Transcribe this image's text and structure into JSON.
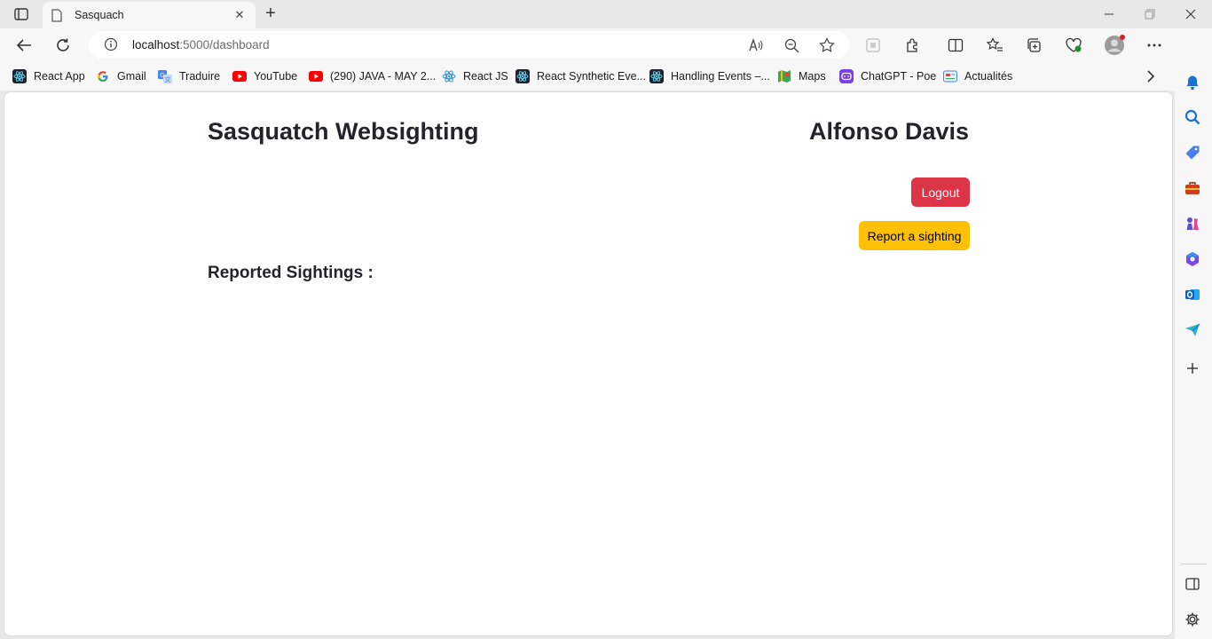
{
  "browser": {
    "tab": {
      "title": "Sasquach",
      "close_symbol": "✕"
    },
    "new_tab_symbol": "+",
    "address": {
      "host": "localhost",
      "path": ":5000/dashboard"
    },
    "window_controls": [
      "minimize-icon",
      "restore-icon",
      "close-icon"
    ],
    "bookmarks": [
      {
        "label": "React App",
        "icon": "react-icon"
      },
      {
        "label": "Gmail",
        "icon": "google-icon"
      },
      {
        "label": "Traduire",
        "icon": "translate-icon"
      },
      {
        "label": "YouTube",
        "icon": "youtube-icon"
      },
      {
        "label": "(290) JAVA - MAY 2...",
        "icon": "youtube-icon"
      },
      {
        "label": "React JS",
        "icon": "react-icon"
      },
      {
        "label": "React Synthetic Eve...",
        "icon": "react-icon"
      },
      {
        "label": "Handling Events –...",
        "icon": "react-icon"
      },
      {
        "label": "Maps",
        "icon": "maps-icon"
      },
      {
        "label": "ChatGPT - Poe",
        "icon": "poe-icon"
      },
      {
        "label": "Actualités",
        "icon": "news-icon"
      }
    ],
    "sidebar_icons": [
      "bell-icon",
      "search-icon",
      "tag-icon",
      "briefcase-icon",
      "chess-icon",
      "office-icon",
      "outlook-icon",
      "send-icon",
      "add-icon",
      "split-panel-icon",
      "settings-icon"
    ]
  },
  "page": {
    "site_title": "Sasquatch Websighting",
    "user_name": "Alfonso Davis",
    "logout_label": "Logout",
    "report_label": "Report a sighting",
    "sightings_heading": "Reported Sightings :"
  },
  "colors": {
    "logout_bg": "#dc3545",
    "report_bg": "#ffc107",
    "youtube_red": "#ff0000",
    "edge_blue": "#1b6fd6"
  }
}
